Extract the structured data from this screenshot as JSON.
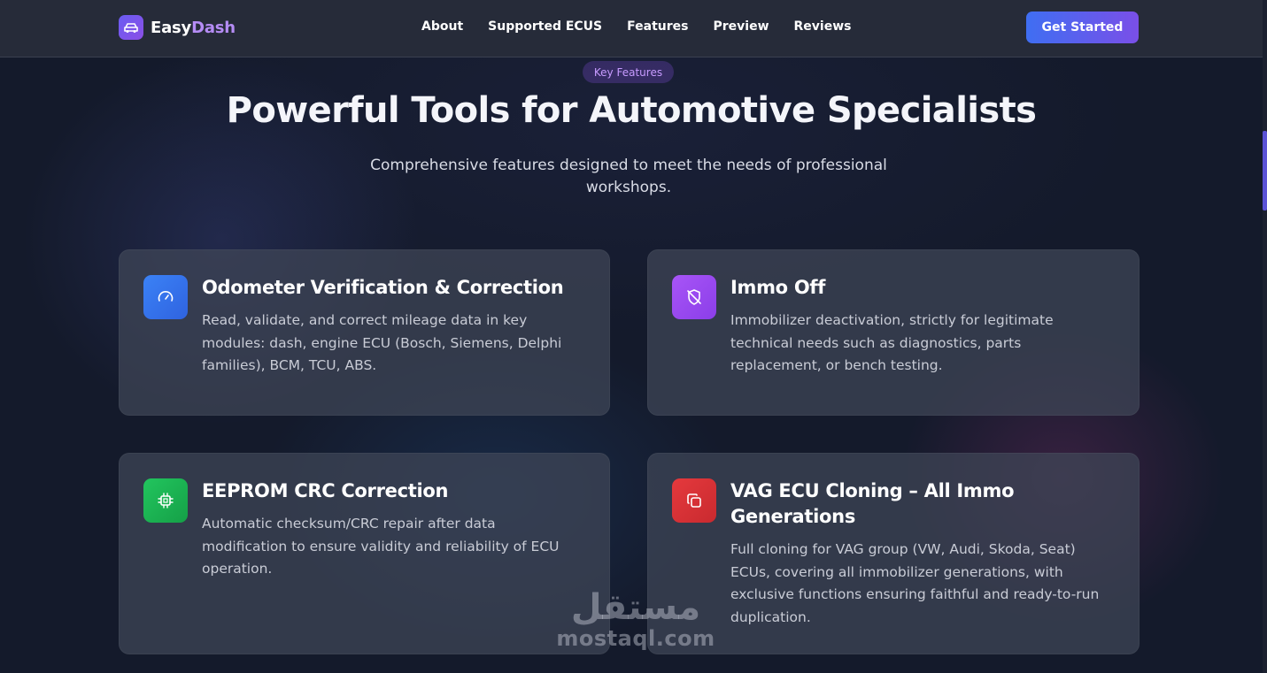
{
  "brand": {
    "name_part1": "Easy",
    "name_part2": "Dash",
    "logo_icon": "car-icon"
  },
  "nav": {
    "links": [
      "About",
      "Supported ECUS",
      "Features",
      "Preview",
      "Reviews"
    ],
    "cta_label": "Get Started"
  },
  "hero": {
    "badge": "Key Features",
    "title": "Powerful Tools for Automotive Specialists",
    "subtitle": "Comprehensive features designed to meet the needs of professional workshops."
  },
  "features": [
    {
      "title": "Odometer Verification & Correction",
      "description": "Read, validate, and correct mileage data in key modules: dash, engine ECU (Bosch, Siemens, Delphi families), BCM, TCU, ABS.",
      "icon": "speedometer-icon",
      "color": "#3b82f6"
    },
    {
      "title": "Immo Off",
      "description": "Immobilizer deactivation, strictly for legitimate technical needs such as diagnostics, parts replacement, or bench testing.",
      "icon": "shield-off-icon",
      "color": "#a855f7"
    },
    {
      "title": "EEPROM CRC Correction",
      "description": "Automatic checksum/CRC repair after data modification to ensure validity and reliability of ECU operation.",
      "icon": "chip-icon",
      "color": "#22c55e"
    },
    {
      "title": "VAG ECU Cloning – All Immo Generations",
      "description": "Full cloning for VAG group (VW, Audi, Skoda, Seat) ECUs, covering all immobilizer generations, with exclusive functions ensuring faithful and ready-to-run duplication.",
      "icon": "copy-icon",
      "color": "#e5393d"
    }
  ],
  "watermark": {
    "arabic": "مستقل",
    "latin": "mostaql.com"
  },
  "colors": {
    "background": "#141a2b",
    "navbar": "#262b39",
    "accent_badge": "#c79bff",
    "cta_start": "#3f6ef2",
    "cta_end": "#7a4fe8"
  }
}
